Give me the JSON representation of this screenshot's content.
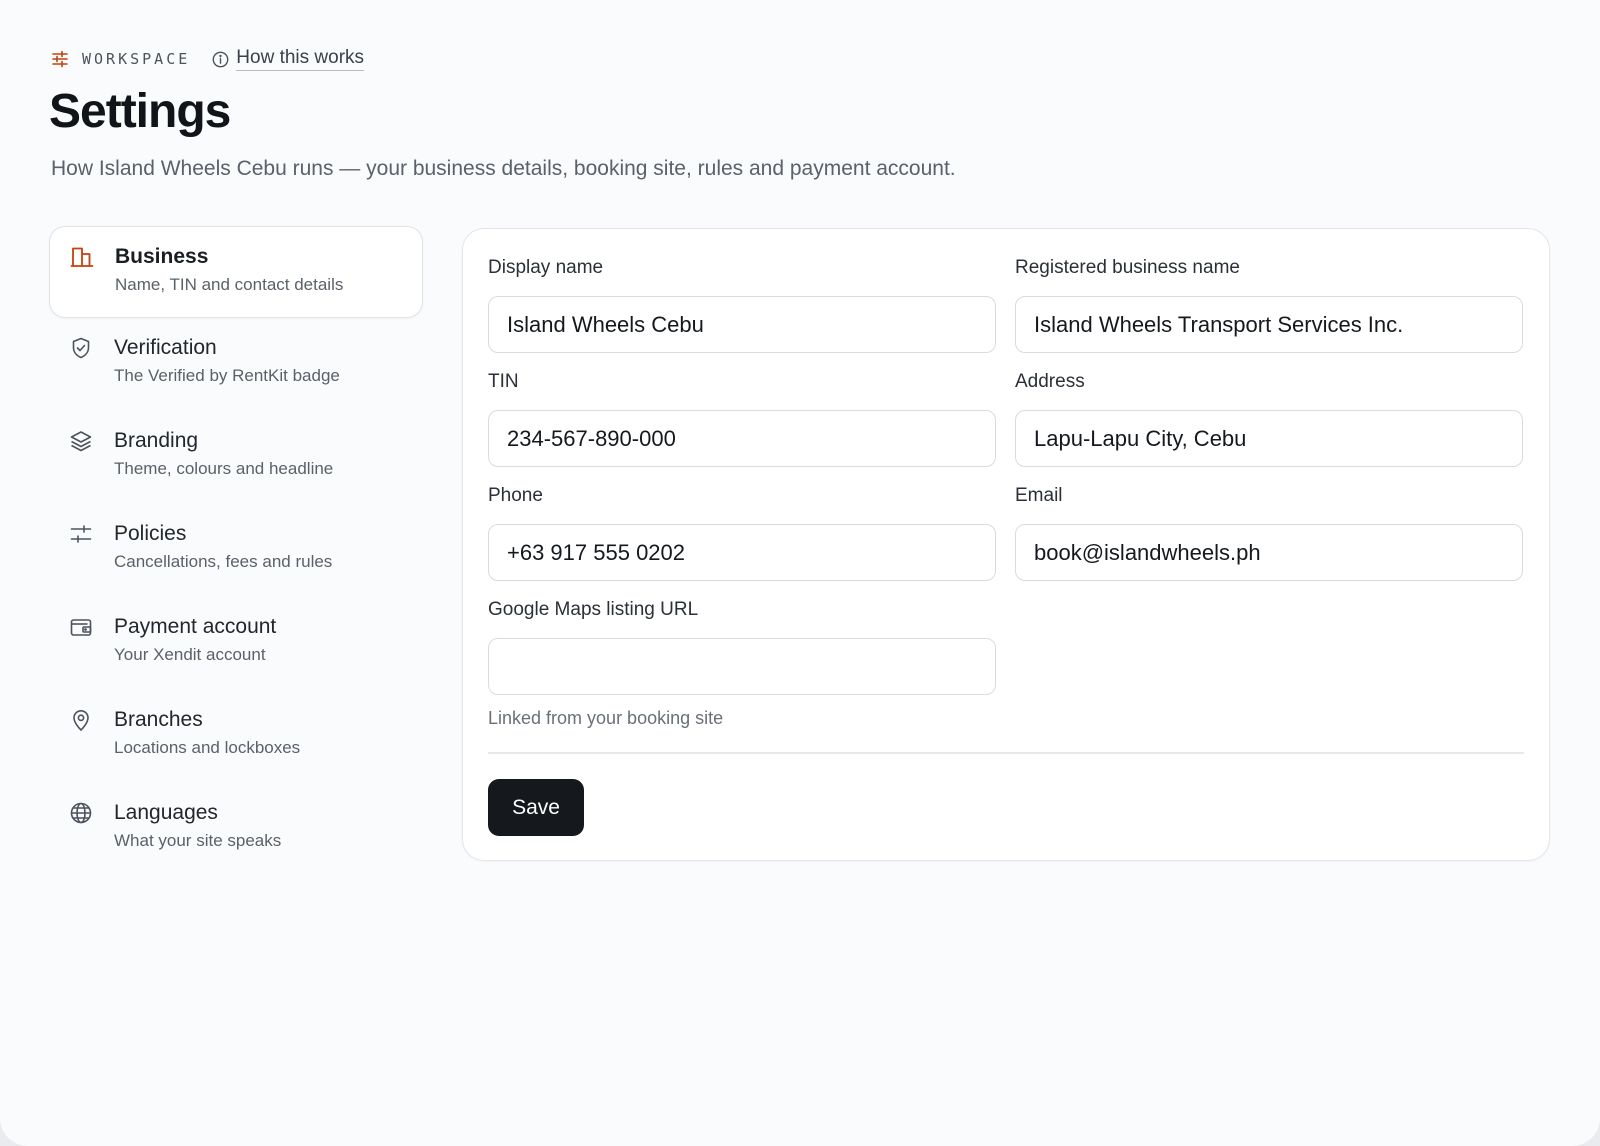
{
  "header": {
    "eyebrow_label": "WORKSPACE",
    "help_link": "How this works",
    "title": "Settings",
    "subtitle": "How Island Wheels Cebu runs — your business details, booking site, rules and payment account."
  },
  "sidebar": {
    "items": [
      {
        "title": "Business",
        "description": "Name, TIN and contact details",
        "icon": "building-icon",
        "active": true
      },
      {
        "title": "Verification",
        "description": "The Verified by RentKit badge",
        "icon": "shield-check-icon",
        "active": false
      },
      {
        "title": "Branding",
        "description": "Theme, colours and headline",
        "icon": "layers-icon",
        "active": false
      },
      {
        "title": "Policies",
        "description": "Cancellations, fees and rules",
        "icon": "sliders-icon",
        "active": false
      },
      {
        "title": "Payment account",
        "description": "Your Xendit account",
        "icon": "wallet-icon",
        "active": false
      },
      {
        "title": "Branches",
        "description": "Locations and lockboxes",
        "icon": "map-pin-icon",
        "active": false
      },
      {
        "title": "Languages",
        "description": "What your site speaks",
        "icon": "globe-icon",
        "active": false
      }
    ]
  },
  "form": {
    "display_name": {
      "label": "Display name",
      "value": "Island Wheels Cebu"
    },
    "registered_name": {
      "label": "Registered business name",
      "value": "Island Wheels Transport Services Inc."
    },
    "tin": {
      "label": "TIN",
      "value": "234-567-890-000"
    },
    "address": {
      "label": "Address",
      "value": "Lapu-Lapu City, Cebu"
    },
    "phone": {
      "label": "Phone",
      "value": "+63 917 555 0202"
    },
    "email": {
      "label": "Email",
      "value": "book@islandwheels.ph"
    },
    "maps_url": {
      "label": "Google Maps listing URL",
      "value": "",
      "helper": "Linked from your booking site"
    },
    "save_label": "Save"
  },
  "colors": {
    "accent": "#c2410c",
    "primary_button": "#15181d",
    "background": "#fafbfc"
  }
}
